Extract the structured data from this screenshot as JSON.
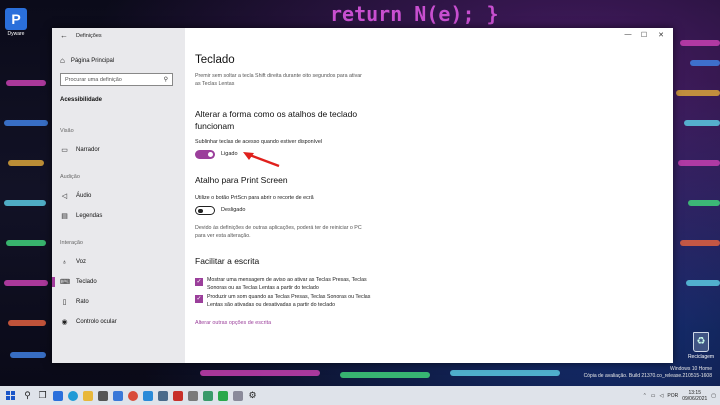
{
  "desktop": {
    "icon_label": "Dyware",
    "recycle_label": "Reciclagem",
    "code_text": "return N(e); }",
    "watermark": [
      "Windows 10 Home",
      "Cópia de avaliação. Build 21370.co_release.210515-1608"
    ]
  },
  "window": {
    "title": "Definições",
    "controls": {
      "minimize": "—",
      "maximize": "☐",
      "close": "✕"
    }
  },
  "sidebar": {
    "home": "Página Principal",
    "search_placeholder": "Procurar uma definição",
    "section": "Acessibilidade",
    "groups": [
      {
        "label": "Visão",
        "items": [
          {
            "label": "Narrador",
            "icon": "narrator-icon"
          }
        ]
      },
      {
        "label": "Audição",
        "items": [
          {
            "label": "Áudio",
            "icon": "speaker-icon"
          },
          {
            "label": "Legendas",
            "icon": "captions-icon"
          }
        ]
      },
      {
        "label": "Interação",
        "items": [
          {
            "label": "Voz",
            "icon": "microphone-icon"
          },
          {
            "label": "Teclado",
            "icon": "keyboard-icon"
          },
          {
            "label": "Rato",
            "icon": "mouse-icon"
          },
          {
            "label": "Controlo ocular",
            "icon": "eye-icon"
          }
        ]
      }
    ],
    "active": "Teclado"
  },
  "main": {
    "title": "Teclado",
    "intro": [
      "Premir sem soltar a tecla Shift direita durante oito segundos para ativar",
      "as Teclas Lentas"
    ],
    "shortcuts_heading": [
      "Alterar a forma como os atalhos de teclado",
      "funcionam"
    ],
    "underline_label": "Sublinhar teclas de acesso quando estiver disponível",
    "underline_toggle": "Ligado",
    "printscreen_heading": "Atalho para Print Screen",
    "printscreen_label": "Utilize o botão PrtScn para abrir o recorte de ecrã",
    "printscreen_toggle": "Desligado",
    "printscreen_note": [
      "Devido às definições de outras aplicações, poderá ter de reiniciar o PC",
      "para ver esta alteração."
    ],
    "typing_heading": "Facilitar a escrita",
    "checkbox1": [
      "Mostrar uma mensagem de aviso ao ativar as Teclas Presas, Teclas",
      "Sonoras ou as Teclas Lentas a partir do teclado"
    ],
    "checkbox2": [
      "Produzir um som quando as Teclas Presas, Teclas Sonoras ou Teclas",
      "Lentas são ativadas ou desativadas a partir do teclado"
    ],
    "link": "Alterar outras opções de escrita"
  },
  "taskbar": {
    "lang": "POR",
    "time": "13:15",
    "date": "09/06/2021"
  },
  "colors": {
    "accent": "#9b3f9b",
    "arrow": "#e0201c"
  }
}
